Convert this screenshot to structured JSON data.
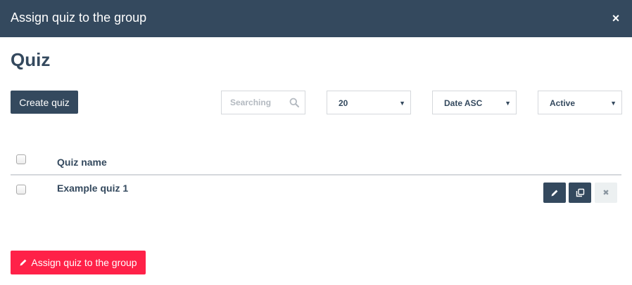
{
  "modal": {
    "title": "Assign quiz to the group",
    "close_glyph": "×",
    "close_icon": "close-icon"
  },
  "page": {
    "title": "Quiz"
  },
  "toolbar": {
    "create_label": "Create quiz",
    "search_placeholder": "Searching",
    "search_icon": "search-icon",
    "per_page": "20",
    "sort": "Date ASC",
    "status": "Active",
    "caret_glyph": "▼"
  },
  "table": {
    "columns": [
      "Quiz name"
    ],
    "rows": [
      {
        "name": "Example quiz 1"
      }
    ],
    "row_actions": [
      "pencil-icon",
      "copy-icon",
      "close-icon"
    ],
    "delete_glyph": "✖"
  },
  "footer": {
    "assign_label": "Assign quiz to the group",
    "assign_icon": "pencil-icon"
  },
  "colors": {
    "header_bg": "#34495e",
    "primary": "#34495e",
    "accent": "#ff2148",
    "border": "#d5d8dc"
  }
}
